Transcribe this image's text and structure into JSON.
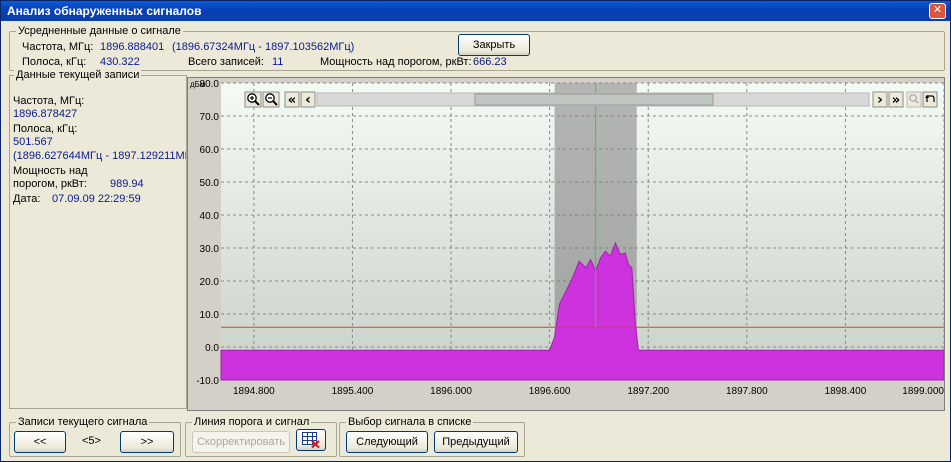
{
  "window": {
    "title": "Анализ обнаруженных сигналов",
    "close_glyph": "✕"
  },
  "averaged": {
    "group_title": "Усредненные данные о сигнале",
    "freq_label": "Частота, МГц:",
    "freq_value": "1896.888401",
    "freq_range": "(1896.67324МГц - 1897.103562МГц)",
    "band_label": "Полоса, кГц:",
    "band_value": "430.322",
    "records_label": "Всего записей:",
    "records_value": "11",
    "power_label": "Мощность над порогом, ркВт:",
    "power_value": "666.23",
    "close_button": "Закрыть"
  },
  "current": {
    "group_title": "Данные текущей записи",
    "freq_label": "Частота, МГц:",
    "freq_value": "1896.878427",
    "band_label": "Полоса, кГц:",
    "band_value": "501.567",
    "band_range": "(1896.627644МГц - 1897.129211МГ",
    "power_label_1": "Мощность над",
    "power_label_2": "порогом, ркВт:",
    "power_value": "989.94",
    "date_label": "Дата:",
    "date_value": "07.09.09 22:29:59"
  },
  "toolbar": {
    "zoom_in_icon": "magnifier-plus-icon",
    "zoom_out_icon": "magnifier-minus-icon",
    "first_glyph": "«",
    "prev_glyph": "‹",
    "next_glyph": "›",
    "last_glyph": "»"
  },
  "bottom": {
    "records_group": "Записи текущего сигнала",
    "prev_button": "<<",
    "counter": "<5>",
    "next_button": ">>",
    "threshold_group": "Линия порога и сигнал",
    "correct_button": "Скорректировать",
    "select_group": "Выбор сигнала в списке",
    "next_signal_button": "Следующий",
    "prev_signal_button": "Предыдущий"
  },
  "chart_data": {
    "type": "area",
    "ylabel": "дБм",
    "ylim": [
      -10,
      80
    ],
    "xlim": [
      1894.6,
      1899.0
    ],
    "y_ticks": [
      "80.0",
      "70.0",
      "60.0",
      "50.0",
      "40.0",
      "30.0",
      "20.0",
      "10.0",
      "0.0",
      "-10.0"
    ],
    "x_ticks": [
      "1894.800",
      "1895.400",
      "1896.000",
      "1896.600",
      "1897.200",
      "1897.800",
      "1898.400",
      "1899.000"
    ],
    "threshold": 6,
    "center_marker": 1896.88,
    "selection_range": [
      1896.63,
      1897.13
    ],
    "colors": {
      "fill": "#cc33dd",
      "threshold": "#d04a20",
      "marker": "#33cc44",
      "selection": "#7e7e7e"
    },
    "series": [
      {
        "x": [
          1894.6,
          1896.6,
          1896.63,
          1896.66,
          1896.7,
          1896.74,
          1896.78,
          1896.82,
          1896.85,
          1896.88,
          1896.91,
          1896.94,
          1896.97,
          1897.0,
          1897.03,
          1897.06,
          1897.08,
          1897.1,
          1897.12,
          1897.14,
          1899.0
        ],
        "y": [
          -1,
          -1,
          3,
          13,
          17,
          21,
          26,
          24,
          26.5,
          23,
          27,
          29,
          27.5,
          31.5,
          28,
          28.5,
          25,
          24,
          8,
          -1,
          -1
        ]
      }
    ]
  }
}
